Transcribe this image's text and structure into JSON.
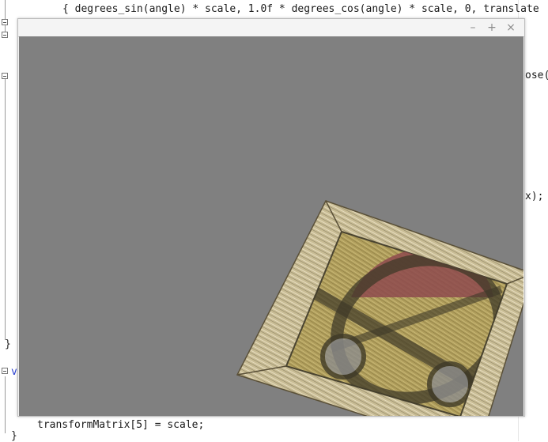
{
  "editor": {
    "code_line_top": "{ degrees_sin(angle) * scale, 1.0f * degrees_cos(angle) * scale, 0, translate",
    "code_fragment_pose": "ose(",
    "code_fragment_x": "x);",
    "code_line_bottom": "transformMatrix[5] = scale;",
    "brace_close_1": "}",
    "brace_close_2": "}",
    "keyword_v": "v"
  },
  "window": {
    "minimize_label": "–",
    "maximize_label": "+",
    "close_label": "×"
  },
  "colors": {
    "viewport_bg": "#808080",
    "crate_wood": "#cfc39a",
    "crate_symbol": "#b8a84a",
    "crate_red": "#8e4a4e"
  }
}
